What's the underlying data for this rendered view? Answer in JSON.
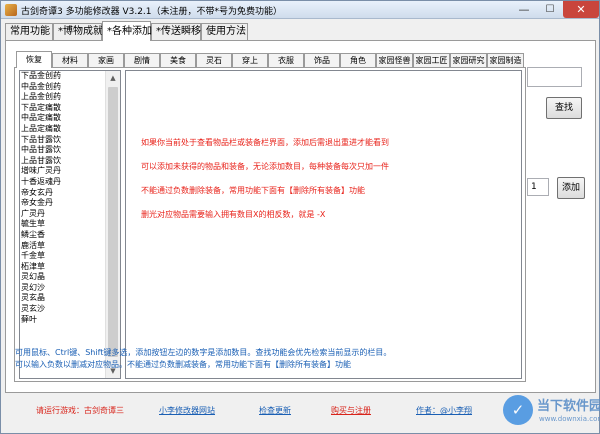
{
  "window": {
    "title": "古剑奇谭3 多功能修改器  V3.2.1（未注册，不带*号为免费功能）",
    "minimize_glyph": "—",
    "maximize_glyph": "☐",
    "close_glyph": "✕"
  },
  "main_tabs": [
    {
      "label": "常用功能"
    },
    {
      "label": "*博物成就"
    },
    {
      "label": "*各种添加"
    },
    {
      "label": "*传送瞬移"
    },
    {
      "label": "使用方法"
    }
  ],
  "sub_tabs": [
    {
      "label": "恢复"
    },
    {
      "label": "材料"
    },
    {
      "label": "家画"
    },
    {
      "label": "剧情"
    },
    {
      "label": "美食"
    },
    {
      "label": "灵石"
    },
    {
      "label": "穿上"
    },
    {
      "label": "衣服"
    },
    {
      "label": "饰品"
    },
    {
      "label": "角色"
    },
    {
      "label": "家园怪兽"
    },
    {
      "label": "家园工匠"
    },
    {
      "label": "家园研究"
    },
    {
      "label": "家园制造"
    }
  ],
  "item_list": [
    "下品金创药",
    "中品金创药",
    "上品金创药",
    "下品定痛散",
    "中品定痛散",
    "上品定痛散",
    "下品甘露饮",
    "中品甘露饮",
    "上品甘露饮",
    "增味广灵丹",
    "十香返魂丹",
    "帝女玄丹",
    "帝女金丹",
    "广灵丹",
    "毓生草",
    "鳞尘香",
    "鹿活草",
    "千金草",
    "柘津草",
    "灵幻晶",
    "灵幻沙",
    "灵玄晶",
    "灵玄沙",
    "藓叶"
  ],
  "info_lines": [
    "如果你当前处于查看物品栏或装备栏界面，添加后需退出重进才能看到",
    "可以添加未获得的物品和装备，无论添加数目，每种装备每次只加一件",
    "不能通过负数删除装备，常用功能下面有【删除所有装备】功能",
    "删光对应物品需要输入拥有数目X的相反数，就是 -X"
  ],
  "search": {
    "value": "",
    "button_label": "查找"
  },
  "add": {
    "quantity": "1",
    "button_label": "添加"
  },
  "help_lines": [
    "可用鼠标、Ctrl键、Shift键多选，添加按钮左边的数字是添加数目。查找功能会优先检索当前显示的栏目。",
    "可以输入负数以删减对应物品。不能通过负数删减装备，常用功能下面有【删除所有装备】功能"
  ],
  "footer": {
    "game_label": "请运行游戏：古剑奇谭三",
    "site_link": "小李修改器网站",
    "update_link": "检查更新",
    "register_link": "购买与注册",
    "author_link": "作者：@小李翔"
  },
  "watermark": {
    "circle_glyph": "✓",
    "brand": "当下软件园",
    "url": "www.downxia.com"
  },
  "colors": {
    "warning_red": "#e8231b",
    "help_blue": "#1a5fb4",
    "link_red": "#d8231a"
  }
}
